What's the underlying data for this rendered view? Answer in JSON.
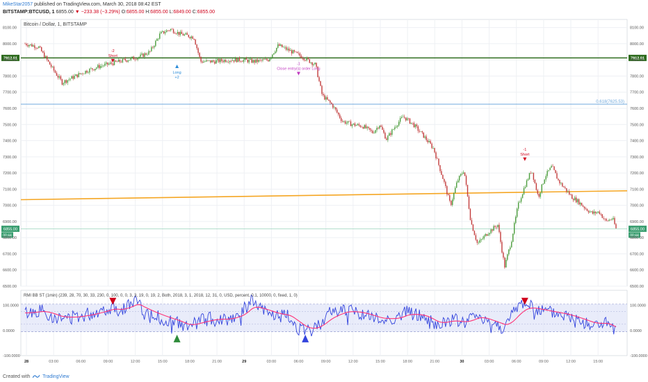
{
  "header": {
    "author": "MikeStar2057",
    "published": "published on TradingView.com, March 30, 2018 08:42 EST",
    "symbol": "BITSTAMP:BTCUSD, 1",
    "price": "6855.00",
    "change": "▼ −233.38 (−3.29%)",
    "o": "O:",
    "o_val": "6855.00",
    "h": "H:",
    "h_val": "6855.00",
    "l": "L:",
    "l_val": "6849.00",
    "c": "C:",
    "c_val": "6855.00"
  },
  "footer": {
    "created_with": "Created with",
    "brand": "TradingView"
  },
  "colors": {
    "candle_up": "#4a9c3b",
    "candle_down": "#c23b3b",
    "green_line": "#2e6b1e",
    "orange_line": "#f5a623",
    "fib_line": "#6fa8dc",
    "grid": "#eef0f4",
    "osc_line": "#3344dd",
    "osc_signal": "#ff3377",
    "osc_band": "#e0e4f8",
    "label_green": "#2e6b1e",
    "label_teal": "#3a9e70"
  },
  "chart_data": [
    {
      "type": "candlestick",
      "title": "Bitcoin / Dollar, 1, BITSTAMP",
      "ylim": [
        6500,
        8150
      ],
      "yticks": [
        "8100.00",
        "8000.00",
        "7900.00",
        "7800.00",
        "7700.00",
        "7600.00",
        "7500.00",
        "7400.00",
        "7300.00",
        "7200.00",
        "7100.00",
        "7000.00",
        "6900.00",
        "6800.00",
        "6700.00",
        "6600.00",
        "6500.00"
      ],
      "x_ticks": [
        "28",
        "03:00",
        "06:00",
        "09:00",
        "12:00",
        "15:00",
        "18:00",
        "21:00",
        "29",
        "03:00",
        "06:00",
        "09:00",
        "12:00",
        "15:00",
        "18:00",
        "21:00",
        "30",
        "03:00",
        "06:00",
        "09:00",
        "12:00",
        "15:00"
      ],
      "price_path": [
        [
          0,
          8000
        ],
        [
          4,
          7980
        ],
        [
          8,
          7850
        ],
        [
          11,
          7760
        ],
        [
          14,
          7790
        ],
        [
          18,
          7830
        ],
        [
          22,
          7860
        ],
        [
          26,
          7880
        ],
        [
          30,
          7900
        ],
        [
          34,
          7920
        ],
        [
          37,
          7950
        ],
        [
          40,
          8060
        ],
        [
          43,
          8090
        ],
        [
          46,
          8060
        ],
        [
          50,
          8040
        ],
        [
          52,
          7890
        ],
        [
          56,
          7890
        ],
        [
          60,
          7900
        ],
        [
          64,
          7900
        ],
        [
          68,
          7890
        ],
        [
          72,
          7900
        ],
        [
          75,
          7990
        ],
        [
          78,
          7960
        ],
        [
          82,
          7920
        ],
        [
          86,
          7870
        ],
        [
          88,
          7680
        ],
        [
          91,
          7620
        ],
        [
          94,
          7520
        ],
        [
          97,
          7500
        ],
        [
          100,
          7490
        ],
        [
          103,
          7450
        ],
        [
          105,
          7500
        ],
        [
          107,
          7410
        ],
        [
          110,
          7500
        ],
        [
          112,
          7550
        ],
        [
          115,
          7500
        ],
        [
          118,
          7430
        ],
        [
          121,
          7350
        ],
        [
          124,
          7150
        ],
        [
          126,
          7000
        ],
        [
          128,
          7150
        ],
        [
          130,
          7220
        ],
        [
          132,
          6900
        ],
        [
          134,
          6760
        ],
        [
          137,
          6830
        ],
        [
          140,
          6880
        ],
        [
          142,
          6620
        ],
        [
          144,
          6780
        ],
        [
          146,
          7000
        ],
        [
          148,
          7120
        ],
        [
          150,
          7220
        ],
        [
          152,
          7050
        ],
        [
          154,
          7180
        ],
        [
          156,
          7240
        ],
        [
          158,
          7150
        ],
        [
          160,
          7100
        ],
        [
          162,
          7050
        ],
        [
          164,
          7020
        ],
        [
          166,
          6980
        ],
        [
          168,
          6950
        ],
        [
          170,
          6960
        ],
        [
          172,
          6900
        ],
        [
          174,
          6920
        ],
        [
          175,
          6855
        ]
      ],
      "hlines": [
        {
          "label": "7912.01",
          "value": 7912.01,
          "color": "green_line"
        },
        {
          "label": "0.618(7625.53)",
          "value": 7625.53,
          "color": "fib_line"
        },
        {
          "label": "6855.00",
          "value": 6855.0,
          "color": "label_teal"
        }
      ],
      "trendline": {
        "from": [
          0,
          7035
        ],
        "to": [
          175,
          7090
        ]
      },
      "last_price_label": "6855.00",
      "countdown": "00:44",
      "annotations": [
        {
          "x": 26,
          "price": 7880,
          "text1": "-2",
          "text2": "Short",
          "dir": "down",
          "color": "#d0021b"
        },
        {
          "x": 45,
          "price": 7875,
          "text1": "Long",
          "text2": "+2",
          "dir": "up",
          "color": "#2a8bd8"
        },
        {
          "x": 81,
          "price": 7800,
          "text1": "-1",
          "text2": "Close entry(s) order Long",
          "dir": "down",
          "color": "#c03ac0"
        },
        {
          "x": 148,
          "price": 7270,
          "text1": "-1",
          "text2": "Short",
          "dir": "down",
          "color": "#d0021b"
        }
      ]
    },
    {
      "type": "line",
      "title": "RMI BB ST (1min) (239, 28, 70, 30, 33, 230, 0, 100, 0, 0, 3, 3, 19, 0, 19, 2, Both, 2018, 3, 1, 2018, 12, 31, 0, USD, percent, 0.1, 10000, 0, fixed, 1, 0)",
      "ylim": [
        -100,
        160
      ],
      "yticks": [
        "100.0000",
        "0.0000",
        "-100.0000"
      ],
      "band": [
        -5,
        105
      ],
      "dashed": [
        75,
        25
      ],
      "series_path": [
        [
          0,
          70
        ],
        [
          5,
          80
        ],
        [
          10,
          45
        ],
        [
          15,
          55
        ],
        [
          20,
          70
        ],
        [
          26,
          95
        ],
        [
          28,
          80
        ],
        [
          33,
          120
        ],
        [
          35,
          75
        ],
        [
          40,
          50
        ],
        [
          45,
          30
        ],
        [
          48,
          10
        ],
        [
          52,
          40
        ],
        [
          56,
          50
        ],
        [
          60,
          45
        ],
        [
          64,
          70
        ],
        [
          67,
          120
        ],
        [
          70,
          80
        ],
        [
          74,
          60
        ],
        [
          78,
          55
        ],
        [
          80,
          20
        ],
        [
          83,
          -10
        ],
        [
          86,
          10
        ],
        [
          90,
          70
        ],
        [
          95,
          85
        ],
        [
          100,
          65
        ],
        [
          105,
          40
        ],
        [
          110,
          50
        ],
        [
          113,
          75
        ],
        [
          118,
          55
        ],
        [
          122,
          15
        ],
        [
          126,
          45
        ],
        [
          130,
          30
        ],
        [
          134,
          65
        ],
        [
          138,
          30
        ],
        [
          142,
          10
        ],
        [
          146,
          100
        ],
        [
          148,
          110
        ],
        [
          152,
          80
        ],
        [
          156,
          70
        ],
        [
          160,
          60
        ],
        [
          164,
          40
        ],
        [
          168,
          20
        ],
        [
          172,
          30
        ],
        [
          175,
          -10
        ]
      ],
      "markers": [
        {
          "x": 26,
          "type": "down",
          "color": "#d0021b"
        },
        {
          "x": 45,
          "type": "up",
          "color": "#2e8b3a"
        },
        {
          "x": 83,
          "type": "up",
          "color": "#3344dd"
        },
        {
          "x": 148,
          "type": "down",
          "color": "#d0021b"
        }
      ]
    }
  ]
}
